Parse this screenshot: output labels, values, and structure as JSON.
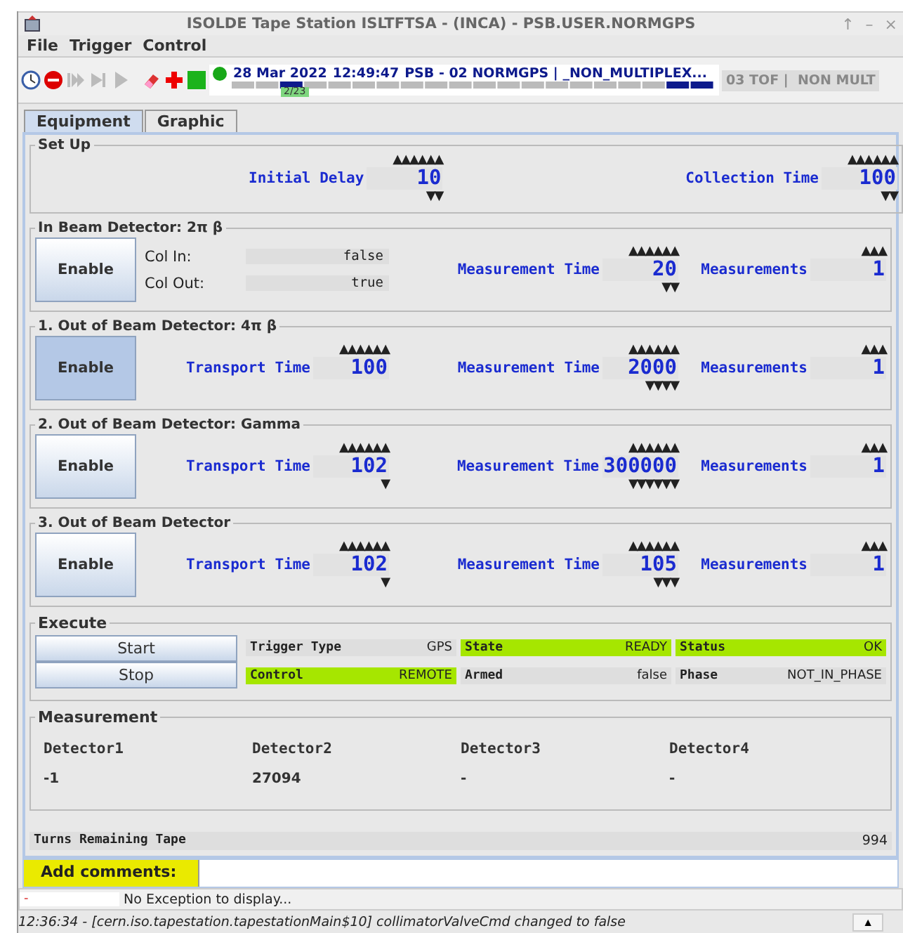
{
  "window": {
    "title": "ISOLDE Tape Station ISLTFTSA - (INCA)  - PSB.USER.NORMGPS",
    "controls": [
      "↑",
      "–",
      "×"
    ]
  },
  "menu": [
    "File",
    "Trigger",
    "Control"
  ],
  "toolbar": [
    {
      "kind": "clock",
      "disabled": false
    },
    {
      "kind": "stop",
      "disabled": false
    },
    {
      "kind": "step-forward",
      "disabled": true
    },
    {
      "kind": "step",
      "disabled": true
    },
    {
      "kind": "play",
      "disabled": true
    },
    {
      "kind": "eraser",
      "disabled": false
    },
    {
      "kind": "add",
      "disabled": false
    },
    {
      "kind": "square",
      "disabled": false
    }
  ],
  "timing": {
    "date": "28 Mar 2022",
    "time": "12:49:47",
    "cycle": "PSB - 02 NORMGPS | _NON_MULTIPLEX...",
    "counter": "2/23",
    "next": "03 TOF |  NON MULT"
  },
  "tabs": [
    {
      "label": "Equipment",
      "selected": true
    },
    {
      "label": "Graphic",
      "selected": false
    }
  ],
  "sections": [
    {
      "kind": "setup",
      "title": "Set Up",
      "fields": [
        {
          "label": "Initial Delay",
          "value": "10",
          "up": "▲▲▲▲▲▲",
          "down": "▼▼"
        },
        {
          "label": "Collection Time",
          "value": "100",
          "up": "▲▲▲▲▲▲",
          "down": "▼▼"
        }
      ]
    },
    {
      "kind": "detector",
      "title": "In Beam Detector: 2π β",
      "enable": {
        "label": "Enable",
        "selected": false
      },
      "valves": [
        {
          "label": "Col In:",
          "value": "false"
        },
        {
          "label": "Col Out:",
          "value": "true"
        }
      ],
      "fields": [
        {
          "label": "Measurement Time",
          "value": "20",
          "up": "▲▲▲▲▲▲",
          "down": "▼▼"
        },
        {
          "label": "Measurements",
          "value": "1",
          "up": "▲▲▲"
        }
      ]
    },
    {
      "kind": "detector",
      "title": "1. Out of Beam Detector: 4π β",
      "enable": {
        "label": "Enable",
        "selected": true
      },
      "fields": [
        {
          "label": "Transport Time",
          "value": "100",
          "up": "▲▲▲▲▲▲"
        },
        {
          "label": "Measurement Time",
          "value": "2000",
          "up": "▲▲▲▲▲▲",
          "down": "▼▼▼▼"
        },
        {
          "label": "Measurements",
          "value": "1",
          "up": "▲▲▲"
        }
      ]
    },
    {
      "kind": "detector",
      "title": "2. Out of Beam Detector: Gamma",
      "enable": {
        "label": "Enable",
        "selected": false
      },
      "fields": [
        {
          "label": "Transport Time",
          "value": "102",
          "up": "▲▲▲▲▲▲",
          "down": "▼"
        },
        {
          "label": "Measurement Time",
          "value": "300000",
          "up": "▲▲▲▲▲▲",
          "down": "▼▼▼▼▼▼"
        },
        {
          "label": "Measurements",
          "value": "1",
          "up": "▲▲▲"
        }
      ]
    },
    {
      "kind": "detector",
      "title": "3. Out of Beam Detector",
      "enable": {
        "label": "Enable",
        "selected": false
      },
      "fields": [
        {
          "label": "Transport Time",
          "value": "102",
          "up": "▲▲▲▲▲▲",
          "down": "▼"
        },
        {
          "label": "Measurement Time",
          "value": "105",
          "up": "▲▲▲▲▲▲",
          "down": "▼▼▼"
        },
        {
          "label": "Measurements",
          "value": "1",
          "up": "▲▲▲"
        }
      ]
    },
    {
      "kind": "execute",
      "title": "Execute",
      "buttons": [
        "Start",
        "Stop"
      ],
      "cells": [
        {
          "label": "Trigger Type",
          "value": "GPS",
          "ok": false
        },
        {
          "label": "State",
          "value": "READY",
          "ok": true
        },
        {
          "label": "Status",
          "value": "OK",
          "ok": true
        },
        {
          "label": "Control",
          "value": "REMOTE",
          "ok": true
        },
        {
          "label": "Armed",
          "value": "false",
          "ok": false
        },
        {
          "label": "Phase",
          "value": "NOT_IN_PHASE",
          "ok": false
        }
      ]
    },
    {
      "kind": "measurement",
      "title": "Measurement",
      "columns": [
        "Detector1",
        "Detector2",
        "Detector3",
        "Detector4"
      ],
      "values": [
        "-1",
        "27094",
        "-",
        "-"
      ]
    }
  ],
  "tape": {
    "label": "Turns Remaining Tape",
    "value": "994"
  },
  "comments": {
    "label": "Add comments:"
  },
  "exception": {
    "code": "-",
    "message": "No Exception to display..."
  },
  "log": {
    "message": "12:36:34 - [cern.iso.tapestation.tapestationMain$10] collimatorValveCmd changed to false",
    "button": "▲"
  }
}
